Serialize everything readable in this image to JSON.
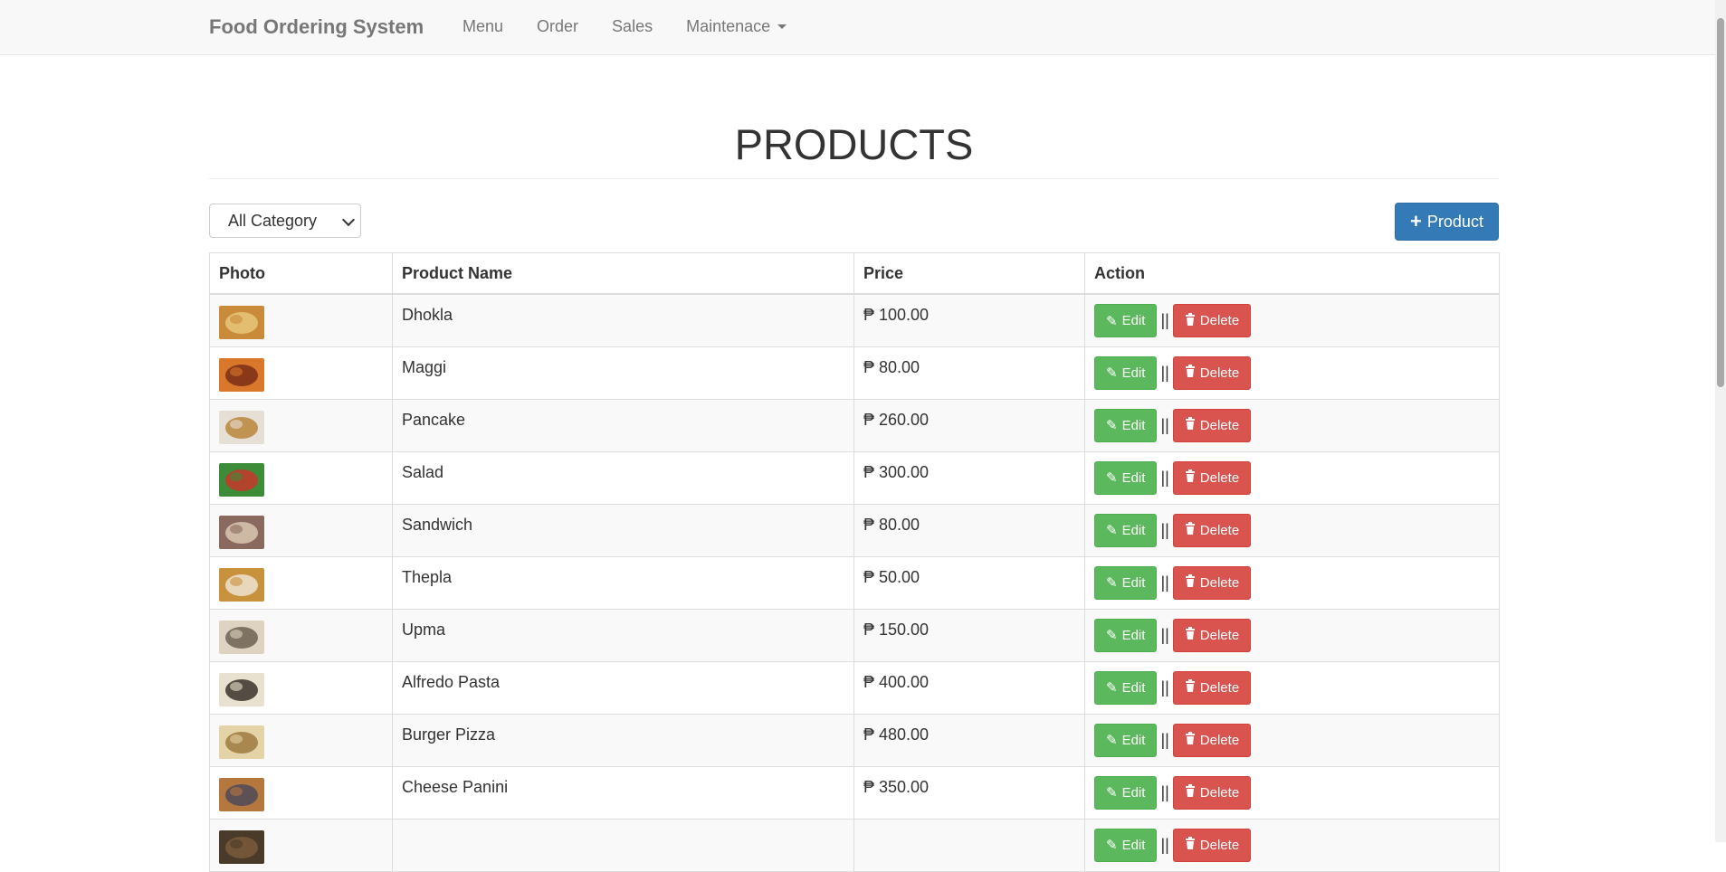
{
  "navbar": {
    "brand": "Food Ordering System",
    "links": [
      {
        "label": "Menu"
      },
      {
        "label": "Order"
      },
      {
        "label": "Sales"
      },
      {
        "label": "Maintenace"
      }
    ]
  },
  "page": {
    "title": "PRODUCTS"
  },
  "filter": {
    "selected": "All Category"
  },
  "add_button": {
    "label": "Product"
  },
  "table": {
    "headers": [
      "Photo",
      "Product Name",
      "Price",
      "Action"
    ],
    "edit_label": "Edit",
    "delete_label": "Delete",
    "separator": "||",
    "rows": [
      {
        "name": "Dhokla",
        "price": "₱ 100.00",
        "thumb": [
          "#c98a3a",
          "#e9c77a"
        ]
      },
      {
        "name": "Maggi",
        "price": "₱ 80.00",
        "thumb": [
          "#d9782a",
          "#7a2e18"
        ]
      },
      {
        "name": "Pancake",
        "price": "₱ 260.00",
        "thumb": [
          "#e6dfd6",
          "#b8863c"
        ]
      },
      {
        "name": "Salad",
        "price": "₱ 300.00",
        "thumb": [
          "#3d8c3a",
          "#c7362a"
        ]
      },
      {
        "name": "Sandwich",
        "price": "₱ 80.00",
        "thumb": [
          "#8a6a5e",
          "#d9c7b2"
        ]
      },
      {
        "name": "Thepla",
        "price": "₱ 50.00",
        "thumb": [
          "#c8913c",
          "#efe3d2"
        ]
      },
      {
        "name": "Upma",
        "price": "₱ 150.00",
        "thumb": [
          "#ddd3c0",
          "#6d6252"
        ]
      },
      {
        "name": "Alfredo Pasta",
        "price": "₱ 400.00",
        "thumb": [
          "#e8e1cf",
          "#3a3029"
        ]
      },
      {
        "name": "Burger Pizza",
        "price": "₱ 480.00",
        "thumb": [
          "#e4d3a7",
          "#9d7a3f"
        ]
      },
      {
        "name": "Cheese Panini",
        "price": "₱ 350.00",
        "thumb": [
          "#b4773e",
          "#4e4a5a"
        ]
      },
      {
        "name": "",
        "price": "",
        "thumb": [
          "#4a3a2a",
          "#7a5a3a"
        ]
      }
    ]
  }
}
